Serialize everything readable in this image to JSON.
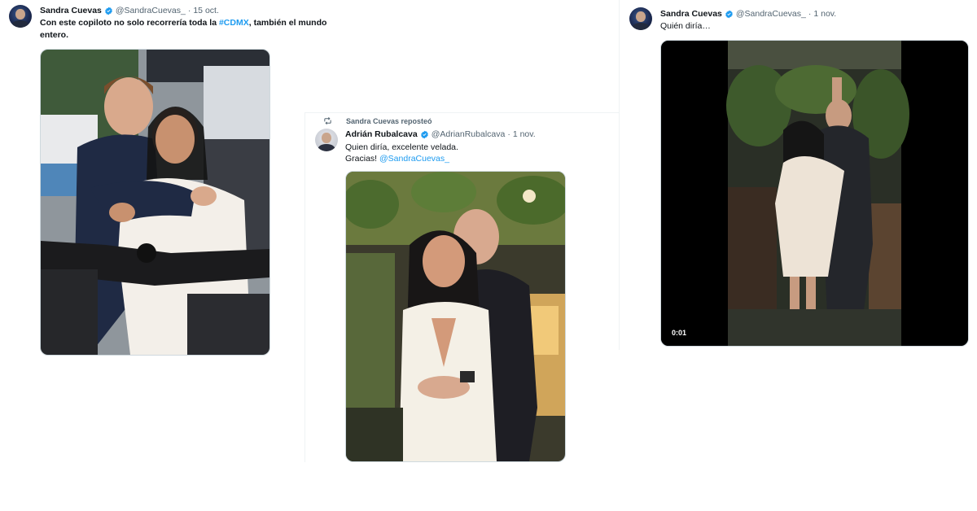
{
  "tweet1": {
    "name": "Sandra Cuevas",
    "handle": "@SandraCuevas_",
    "date": "15 oct.",
    "text_before": "Con este copiloto no solo recorrería toda la ",
    "hashtag": "#CDMX",
    "text_after": ", también el mundo entero.",
    "photo_icon": "photo-couple-motorcycle"
  },
  "tweet2": {
    "repost_label": "Sandra Cuevas reposteó",
    "repost_icon": "repost-icon",
    "name": "Adrián Rubalcava",
    "handle": "@AdrianRubalcava",
    "date": "1 nov.",
    "line1": "Quien diría, excelente velada.",
    "line2_prefix": "Gracias! ",
    "mention": "@SandraCuevas_",
    "photo_icon": "photo-couple-restaurant"
  },
  "tweet3": {
    "name": "Sandra Cuevas",
    "handle": "@SandraCuevas_",
    "date": "1 nov.",
    "text": "Quién diría…",
    "video_time": "0:01",
    "video_icon": "video-couple-hug"
  },
  "colors": {
    "link": "#1d9bf0",
    "verified": "#1d9bf0",
    "secondary_text": "#536471"
  }
}
